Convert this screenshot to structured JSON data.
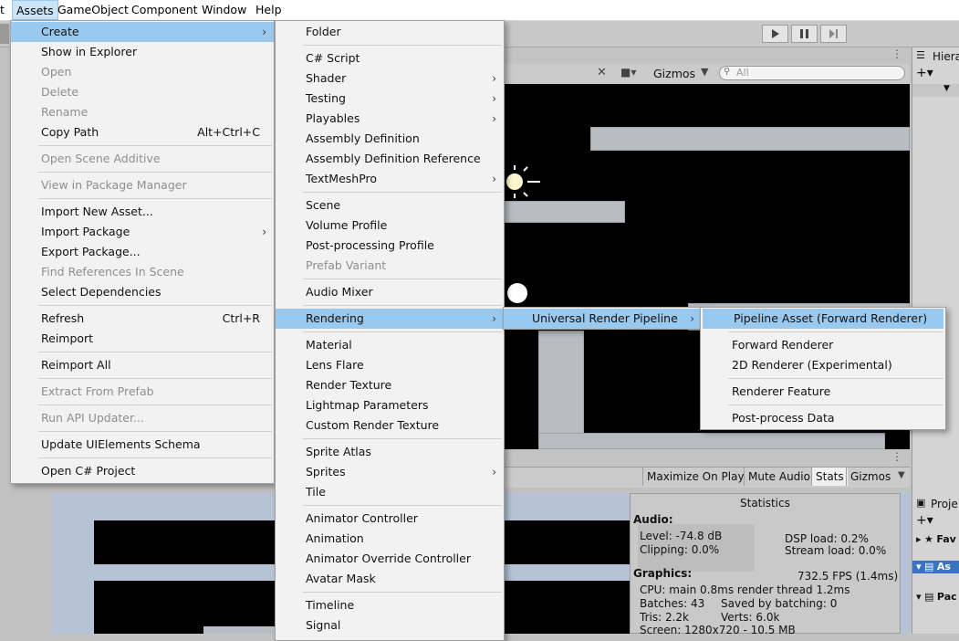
{
  "menubar": [
    {
      "label": "t",
      "x": 0
    },
    {
      "label": "Assets",
      "active": true
    },
    {
      "label": "GameObject"
    },
    {
      "label": "Component"
    },
    {
      "label": "Window"
    },
    {
      "label": "Help"
    }
  ],
  "assets_menu": {
    "items": [
      {
        "label": "Create",
        "type": "submenu",
        "highlight": true
      },
      {
        "label": "Show in Explorer"
      },
      {
        "label": "Open",
        "disabled": true
      },
      {
        "label": "Delete",
        "disabled": true
      },
      {
        "label": "Rename",
        "disabled": true
      },
      {
        "label": "Copy Path",
        "shortcut": "Alt+Ctrl+C"
      },
      {
        "type": "sep"
      },
      {
        "label": "Open Scene Additive",
        "disabled": true
      },
      {
        "type": "sep"
      },
      {
        "label": "View in Package Manager",
        "disabled": true
      },
      {
        "type": "sep"
      },
      {
        "label": "Import New Asset..."
      },
      {
        "label": "Import Package",
        "type": "submenu"
      },
      {
        "label": "Export Package..."
      },
      {
        "label": "Find References In Scene",
        "disabled": true
      },
      {
        "label": "Select Dependencies"
      },
      {
        "type": "sep"
      },
      {
        "label": "Refresh",
        "shortcut": "Ctrl+R"
      },
      {
        "label": "Reimport"
      },
      {
        "type": "sep"
      },
      {
        "label": "Reimport All"
      },
      {
        "type": "sep"
      },
      {
        "label": "Extract From Prefab",
        "disabled": true
      },
      {
        "type": "sep"
      },
      {
        "label": "Run API Updater...",
        "disabled": true
      },
      {
        "type": "sep"
      },
      {
        "label": "Update UIElements Schema"
      },
      {
        "type": "sep"
      },
      {
        "label": "Open C# Project"
      }
    ]
  },
  "create_menu": {
    "items": [
      {
        "label": "Folder"
      },
      {
        "type": "sep"
      },
      {
        "label": "C# Script"
      },
      {
        "label": "Shader",
        "type": "submenu"
      },
      {
        "label": "Testing",
        "type": "submenu"
      },
      {
        "label": "Playables",
        "type": "submenu"
      },
      {
        "label": "Assembly Definition"
      },
      {
        "label": "Assembly Definition Reference"
      },
      {
        "label": "TextMeshPro",
        "type": "submenu"
      },
      {
        "type": "sep"
      },
      {
        "label": "Scene"
      },
      {
        "label": "Volume Profile"
      },
      {
        "label": "Post-processing Profile"
      },
      {
        "label": "Prefab Variant",
        "disabled": true
      },
      {
        "type": "sep"
      },
      {
        "label": "Audio Mixer"
      },
      {
        "type": "sep"
      },
      {
        "label": "Rendering",
        "type": "submenu",
        "highlight": true
      },
      {
        "type": "sep"
      },
      {
        "label": "Material"
      },
      {
        "label": "Lens Flare"
      },
      {
        "label": "Render Texture"
      },
      {
        "label": "Lightmap Parameters"
      },
      {
        "label": "Custom Render Texture"
      },
      {
        "type": "sep"
      },
      {
        "label": "Sprite Atlas"
      },
      {
        "label": "Sprites",
        "type": "submenu"
      },
      {
        "label": "Tile"
      },
      {
        "type": "sep"
      },
      {
        "label": "Animator Controller"
      },
      {
        "label": "Animation"
      },
      {
        "label": "Animator Override Controller"
      },
      {
        "label": "Avatar Mask"
      },
      {
        "type": "sep"
      },
      {
        "label": "Timeline"
      },
      {
        "label": "Signal"
      }
    ]
  },
  "rendering_menu": {
    "items": [
      {
        "label": "Universal Render Pipeline",
        "type": "submenu",
        "highlight": true
      }
    ]
  },
  "urp_menu": {
    "items": [
      {
        "label": "Pipeline Asset (Forward Renderer)",
        "highlight": true
      },
      {
        "type": "sep"
      },
      {
        "label": "Forward Renderer"
      },
      {
        "label": "2D Renderer (Experimental)"
      },
      {
        "type": "sep"
      },
      {
        "label": "Renderer Feature"
      },
      {
        "type": "sep"
      },
      {
        "label": "Post-process Data"
      }
    ]
  },
  "scene_toolbar": {
    "gizmos": "Gizmos",
    "search_placeholder": "All"
  },
  "game_toolbar": {
    "maximize": "Maximize On Play",
    "mute": "Mute Audio",
    "stats": "Stats",
    "gizmos": "Gizmos"
  },
  "hierarchy": {
    "title": "Hiera"
  },
  "project": {
    "title": "Proje",
    "fav": "Fav",
    "assets": "As",
    "packages": "Pac"
  },
  "statistics": {
    "title": "Statistics",
    "audio_heading": "Audio:",
    "level": "Level: -74.8 dB",
    "clipping": "Clipping: 0.0%",
    "dsp": "DSP load: 0.2%",
    "stream": "Stream load: 0.0%",
    "graphics_heading": "Graphics:",
    "fps": "732.5 FPS (1.4ms)",
    "cpu": "CPU: main 0.8ms  render thread 1.2ms",
    "batches": "Batches: 43",
    "saved": "Saved by batching: 0",
    "tris": "Tris: 2.2k",
    "verts": "Verts: 6.0k",
    "screen": "Screen: 1280x720 - 10.5 MB"
  },
  "colors": {
    "highlight": "#99c9ef",
    "menu_bg": "#f2f2f2",
    "disabled": "#8e8e8e"
  }
}
